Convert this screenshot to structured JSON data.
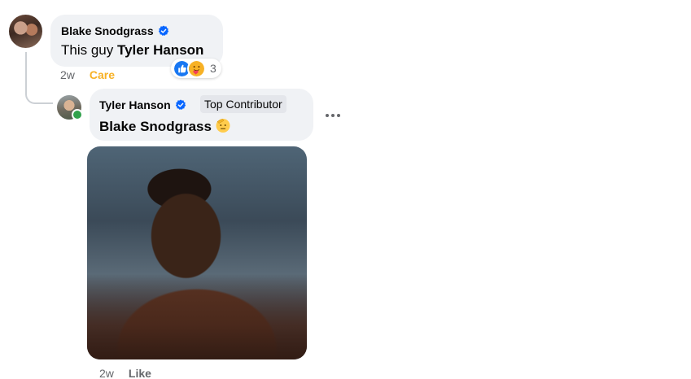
{
  "comment_1": {
    "author": "Blake Snodgrass",
    "text_prefix": "This guy",
    "mention": "Tyler Hanson",
    "reactions": {
      "icons": [
        "like-icon",
        "care-icon"
      ],
      "count": "3"
    },
    "time": "2w",
    "action": "Care"
  },
  "reply_1": {
    "author": "Tyler Hanson",
    "badge": "Top Contributor",
    "mention": "Blake Snodgrass",
    "emoji": "saluting-face",
    "time": "2w",
    "action": "Like",
    "gif": "reaction-gif"
  },
  "colors": {
    "bubble": "#f0f2f5",
    "secondary_text": "#65676b",
    "care": "#f7b125",
    "verified": "#0866ff",
    "online": "#31a24c"
  }
}
